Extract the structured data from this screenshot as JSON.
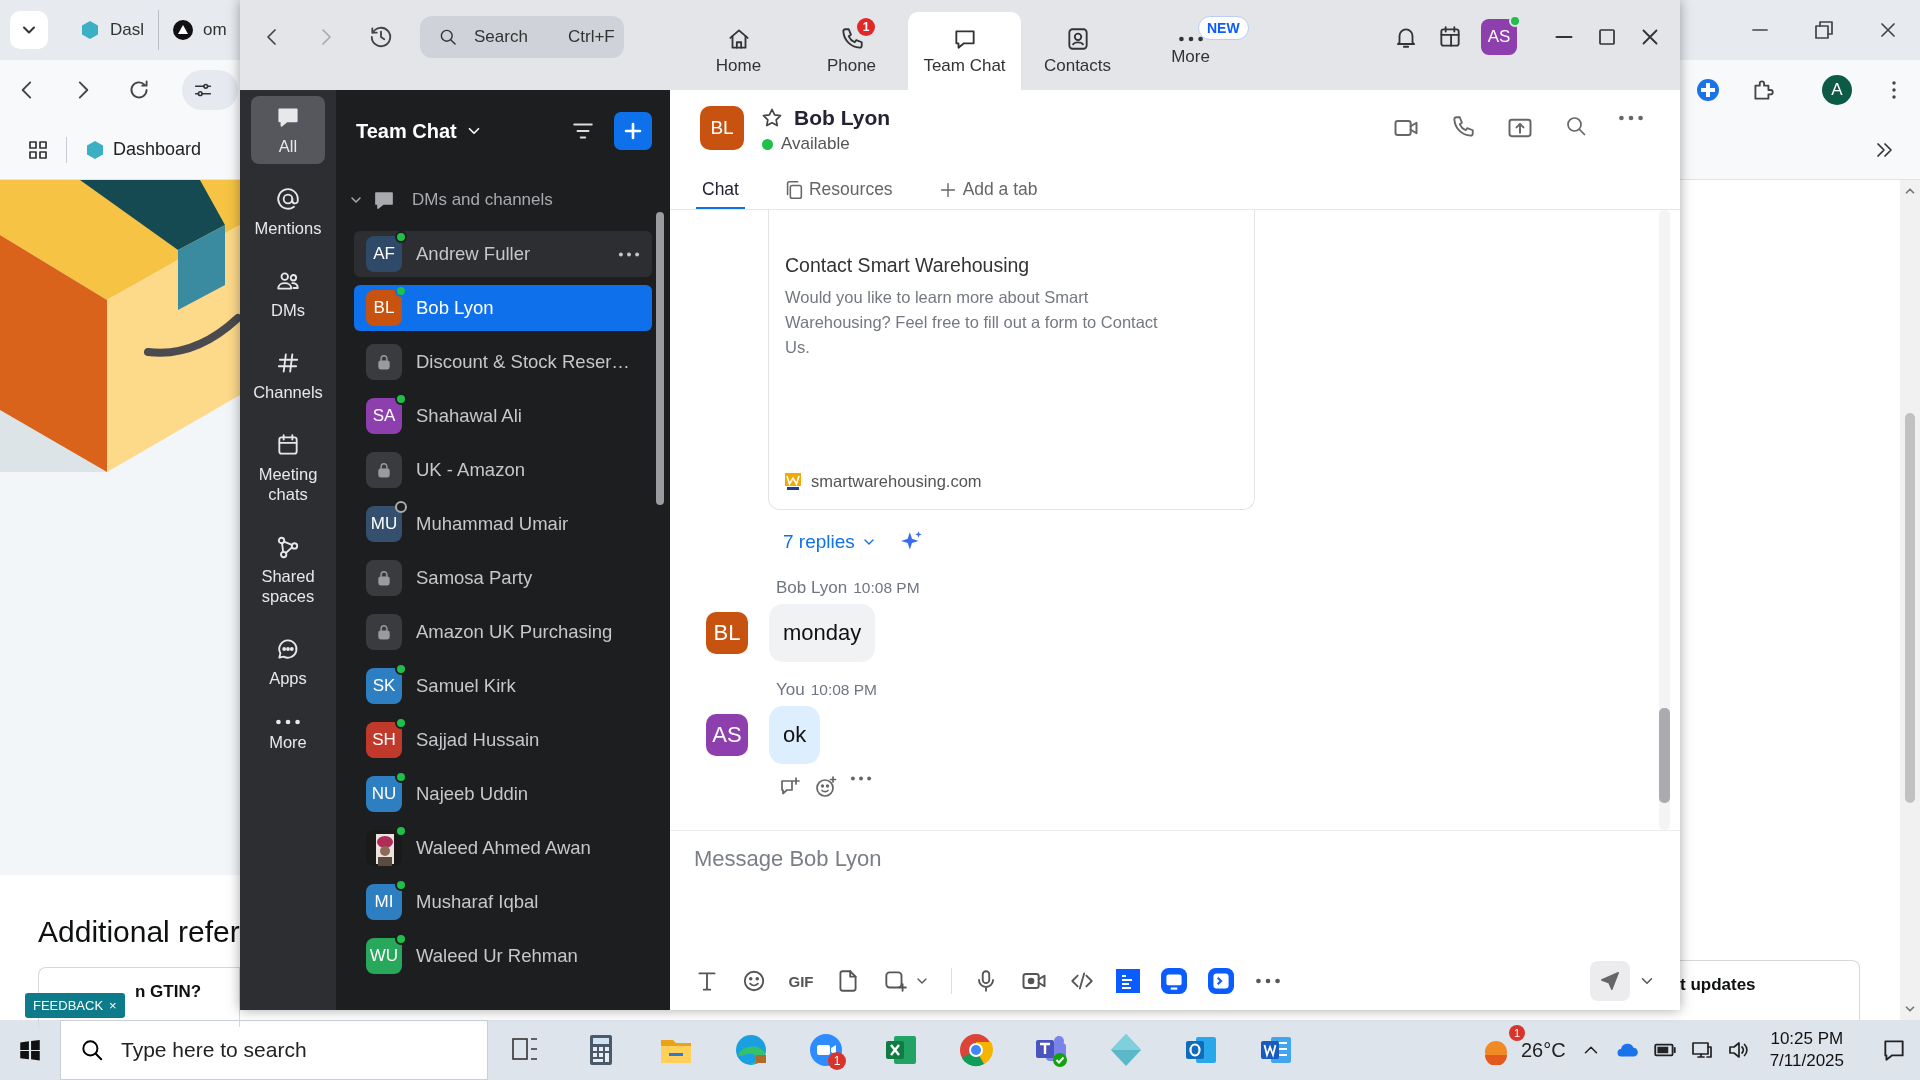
{
  "browser": {
    "tabs": [
      {
        "label": "Dasl"
      },
      {
        "label": "om"
      }
    ],
    "profile_initial": "A",
    "bookmarks": [
      {
        "label": "Dashboard"
      }
    ],
    "page": {
      "heading": "Additional refer",
      "card_text": "n GTIN?",
      "feedback": "FEEDBACK",
      "feedback_close": "×",
      "side_text": "t updates"
    }
  },
  "zoom": {
    "search": {
      "placeholder": "Search",
      "shortcut": "Ctrl+F"
    },
    "nav": [
      {
        "kind": "home",
        "label": "Home",
        "selected": false
      },
      {
        "kind": "phone",
        "label": "Phone",
        "selected": false,
        "badge": "1"
      },
      {
        "kind": "chat",
        "label": "Team Chat",
        "selected": true
      },
      {
        "kind": "contacts",
        "label": "Contacts",
        "selected": false
      },
      {
        "kind": "more",
        "label": "More",
        "selected": false,
        "badge": "NEW"
      }
    ],
    "profile": {
      "initials": "AS",
      "online": true
    },
    "rail": [
      {
        "kind": "chat",
        "label": "All",
        "selected": true
      },
      {
        "kind": "at",
        "label": "Mentions",
        "selected": false
      },
      {
        "kind": "people",
        "label": "DMs",
        "selected": false
      },
      {
        "kind": "hash",
        "label": "Channels",
        "selected": false
      },
      {
        "kind": "calendar",
        "label": "Meeting chats",
        "selected": false
      },
      {
        "kind": "nodes",
        "label": "Shared spaces",
        "selected": false
      },
      {
        "kind": "apps",
        "label": "Apps",
        "selected": false
      },
      {
        "kind": "more",
        "label": "More",
        "selected": false
      }
    ],
    "list": {
      "title": "Team Chat",
      "section": "DMs and channels",
      "expanded": true,
      "items": [
        {
          "kind": "person",
          "name": "Andrew Fuller",
          "initials": "AF",
          "color": "#2f4a68",
          "online": true,
          "selected": false,
          "hovered": true
        },
        {
          "kind": "person",
          "name": "Bob Lyon",
          "initials": "BL",
          "color": "#c8520f",
          "online": true,
          "selected": true,
          "hovered": false
        },
        {
          "kind": "channel",
          "name": "Discount & Stock Reser…",
          "selected": false,
          "hovered": false
        },
        {
          "kind": "person",
          "name": "Shahawal Ali",
          "initials": "SA",
          "color": "#8e3fae",
          "online": true,
          "selected": false,
          "hovered": false
        },
        {
          "kind": "channel",
          "name": "UK - Amazon",
          "selected": false,
          "hovered": false
        },
        {
          "kind": "person",
          "name": "Muhammad Umair",
          "initials": "MU",
          "color": "#34506e",
          "online": false,
          "selected": false,
          "hovered": false
        },
        {
          "kind": "channel",
          "name": "Samosa Party",
          "selected": false,
          "hovered": false
        },
        {
          "kind": "channel",
          "name": "Amazon UK Purchasing",
          "selected": false,
          "hovered": false
        },
        {
          "kind": "person",
          "name": "Samuel Kirk",
          "initials": "SK",
          "color": "#2d7fc1",
          "online": true,
          "selected": false,
          "hovered": false
        },
        {
          "kind": "person",
          "name": "Sajjad Hussain",
          "initials": "SH",
          "color": "#c0392b",
          "online": true,
          "selected": false,
          "hovered": false
        },
        {
          "kind": "person",
          "name": "Najeeb Uddin",
          "initials": "NU",
          "color": "#2d7fc1",
          "online": true,
          "selected": false,
          "hovered": false
        },
        {
          "name": "Waleed Ahmed Awan",
          "online": true,
          "selected": false,
          "hovered": false
        },
        {
          "kind": "person",
          "name": "Musharaf Iqbal",
          "initials": "MI",
          "color": "#2d7fc1",
          "online": true,
          "selected": false,
          "hovered": false
        },
        {
          "kind": "person",
          "name": "Waleed Ur Rehman",
          "initials": "WU",
          "color": "#27a85a",
          "online": true,
          "selected": false,
          "hovered": false
        }
      ]
    },
    "chat": {
      "contact": {
        "initials": "BL",
        "color": "#c8520f",
        "name": "Bob Lyon",
        "status": "Available",
        "starred": false
      },
      "tabs": [
        {
          "kind": "plain",
          "label": "Chat",
          "selected": true
        },
        {
          "kind": "resources",
          "label": "Resources",
          "selected": false
        },
        {
          "kind": "add",
          "label": "Add a tab",
          "selected": false
        }
      ],
      "link_card": {
        "title": "Contact Smart Warehousing",
        "description": "Would you like to learn more about Smart Warehousing? Feel free to fill out a form to Contact Us.",
        "domain": "smartwarehousing.com"
      },
      "replies": "7 replies",
      "messages": [
        {
          "sender": "Bob Lyon",
          "time": "10:08 PM",
          "text": "monday",
          "initials": "BL",
          "color": "#c8520f",
          "mine": false
        },
        {
          "sender": "You",
          "time": "10:08 PM",
          "text": "ok",
          "initials": "AS",
          "color": "#8e3fae",
          "mine": true
        }
      ],
      "composer": {
        "placeholder": "Message Bob Lyon",
        "gif": "GIF"
      }
    }
  },
  "taskbar": {
    "search_placeholder": "Type here to search",
    "apps": [
      {
        "kind": "task-view"
      },
      {
        "kind": "calculator"
      },
      {
        "kind": "folder"
      },
      {
        "kind": "wave-browser"
      },
      {
        "kind": "video-app",
        "badge": "1"
      },
      {
        "kind": "spreadsheet"
      },
      {
        "kind": "round-browser"
      },
      {
        "kind": "team-app"
      },
      {
        "kind": "diamond-app"
      },
      {
        "kind": "mail"
      },
      {
        "kind": "document"
      }
    ],
    "weather": {
      "temp": "26°C",
      "badge": "1"
    },
    "clock": {
      "time": "10:25 PM",
      "date": "7/11/2025"
    }
  }
}
